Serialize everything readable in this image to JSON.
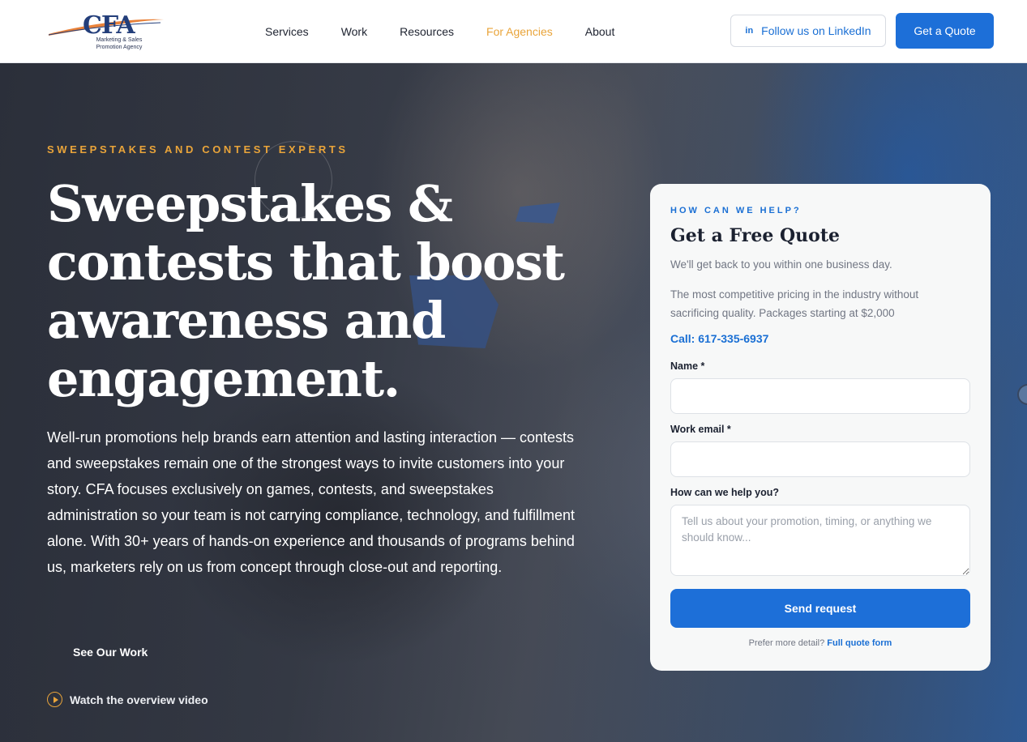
{
  "header": {
    "logo": {
      "name": "CFA",
      "tagline": "Marketing & Sales Promotion Agency"
    },
    "nav": [
      {
        "label": "Services"
      },
      {
        "label": "Work"
      },
      {
        "label": "Resources"
      },
      {
        "label": "For Agencies",
        "active": true
      },
      {
        "label": "About"
      }
    ],
    "linkedin_label": "Follow us on LinkedIn",
    "linkedin_icon": "linkedin-icon",
    "quote_label": "Get a Quote"
  },
  "hero": {
    "eyebrow": "SWEEPSTAKES AND CONTEST EXPERTS",
    "headline": "Sweepstakes & contests that boost awareness and engagement.",
    "body": "Well-run promotions help brands earn attention and lasting interaction — contests and sweepstakes remain one of the strongest ways to invite customers into your story. CFA focuses exclusively on games, contests, and sweepstakes administration so your team is not carrying compliance, technology, and fulfillment alone. With 30+ years of hands-on experience and thousands of programs behind us, marketers rely on us from concept through close-out and reporting.",
    "see_work": "See Our Work",
    "video_label": "Watch the overview video",
    "video_icon": "play-circle-icon"
  },
  "form": {
    "eyebrow": "HOW CAN WE HELP?",
    "title": "Get a Free Quote",
    "sub1": "We'll get back to you within one business day.",
    "sub2": "The most competitive pricing in the industry without sacrificing quality. Packages starting at $2,000",
    "call": "Call: 617-335-6937",
    "name_label": "Name *",
    "name_value": "",
    "email_label": "Work email *",
    "email_value": "",
    "help_label": "How can we help you?",
    "help_placeholder": "Tell us about your promotion, timing, or anything we should know...",
    "send_label": "Send request",
    "footer_prefix": "Prefer more detail?",
    "footer_link": "Full quote form"
  },
  "colors": {
    "accent": "#1d6fd8",
    "highlight": "#e9a43a",
    "navy": "#233e7a"
  }
}
